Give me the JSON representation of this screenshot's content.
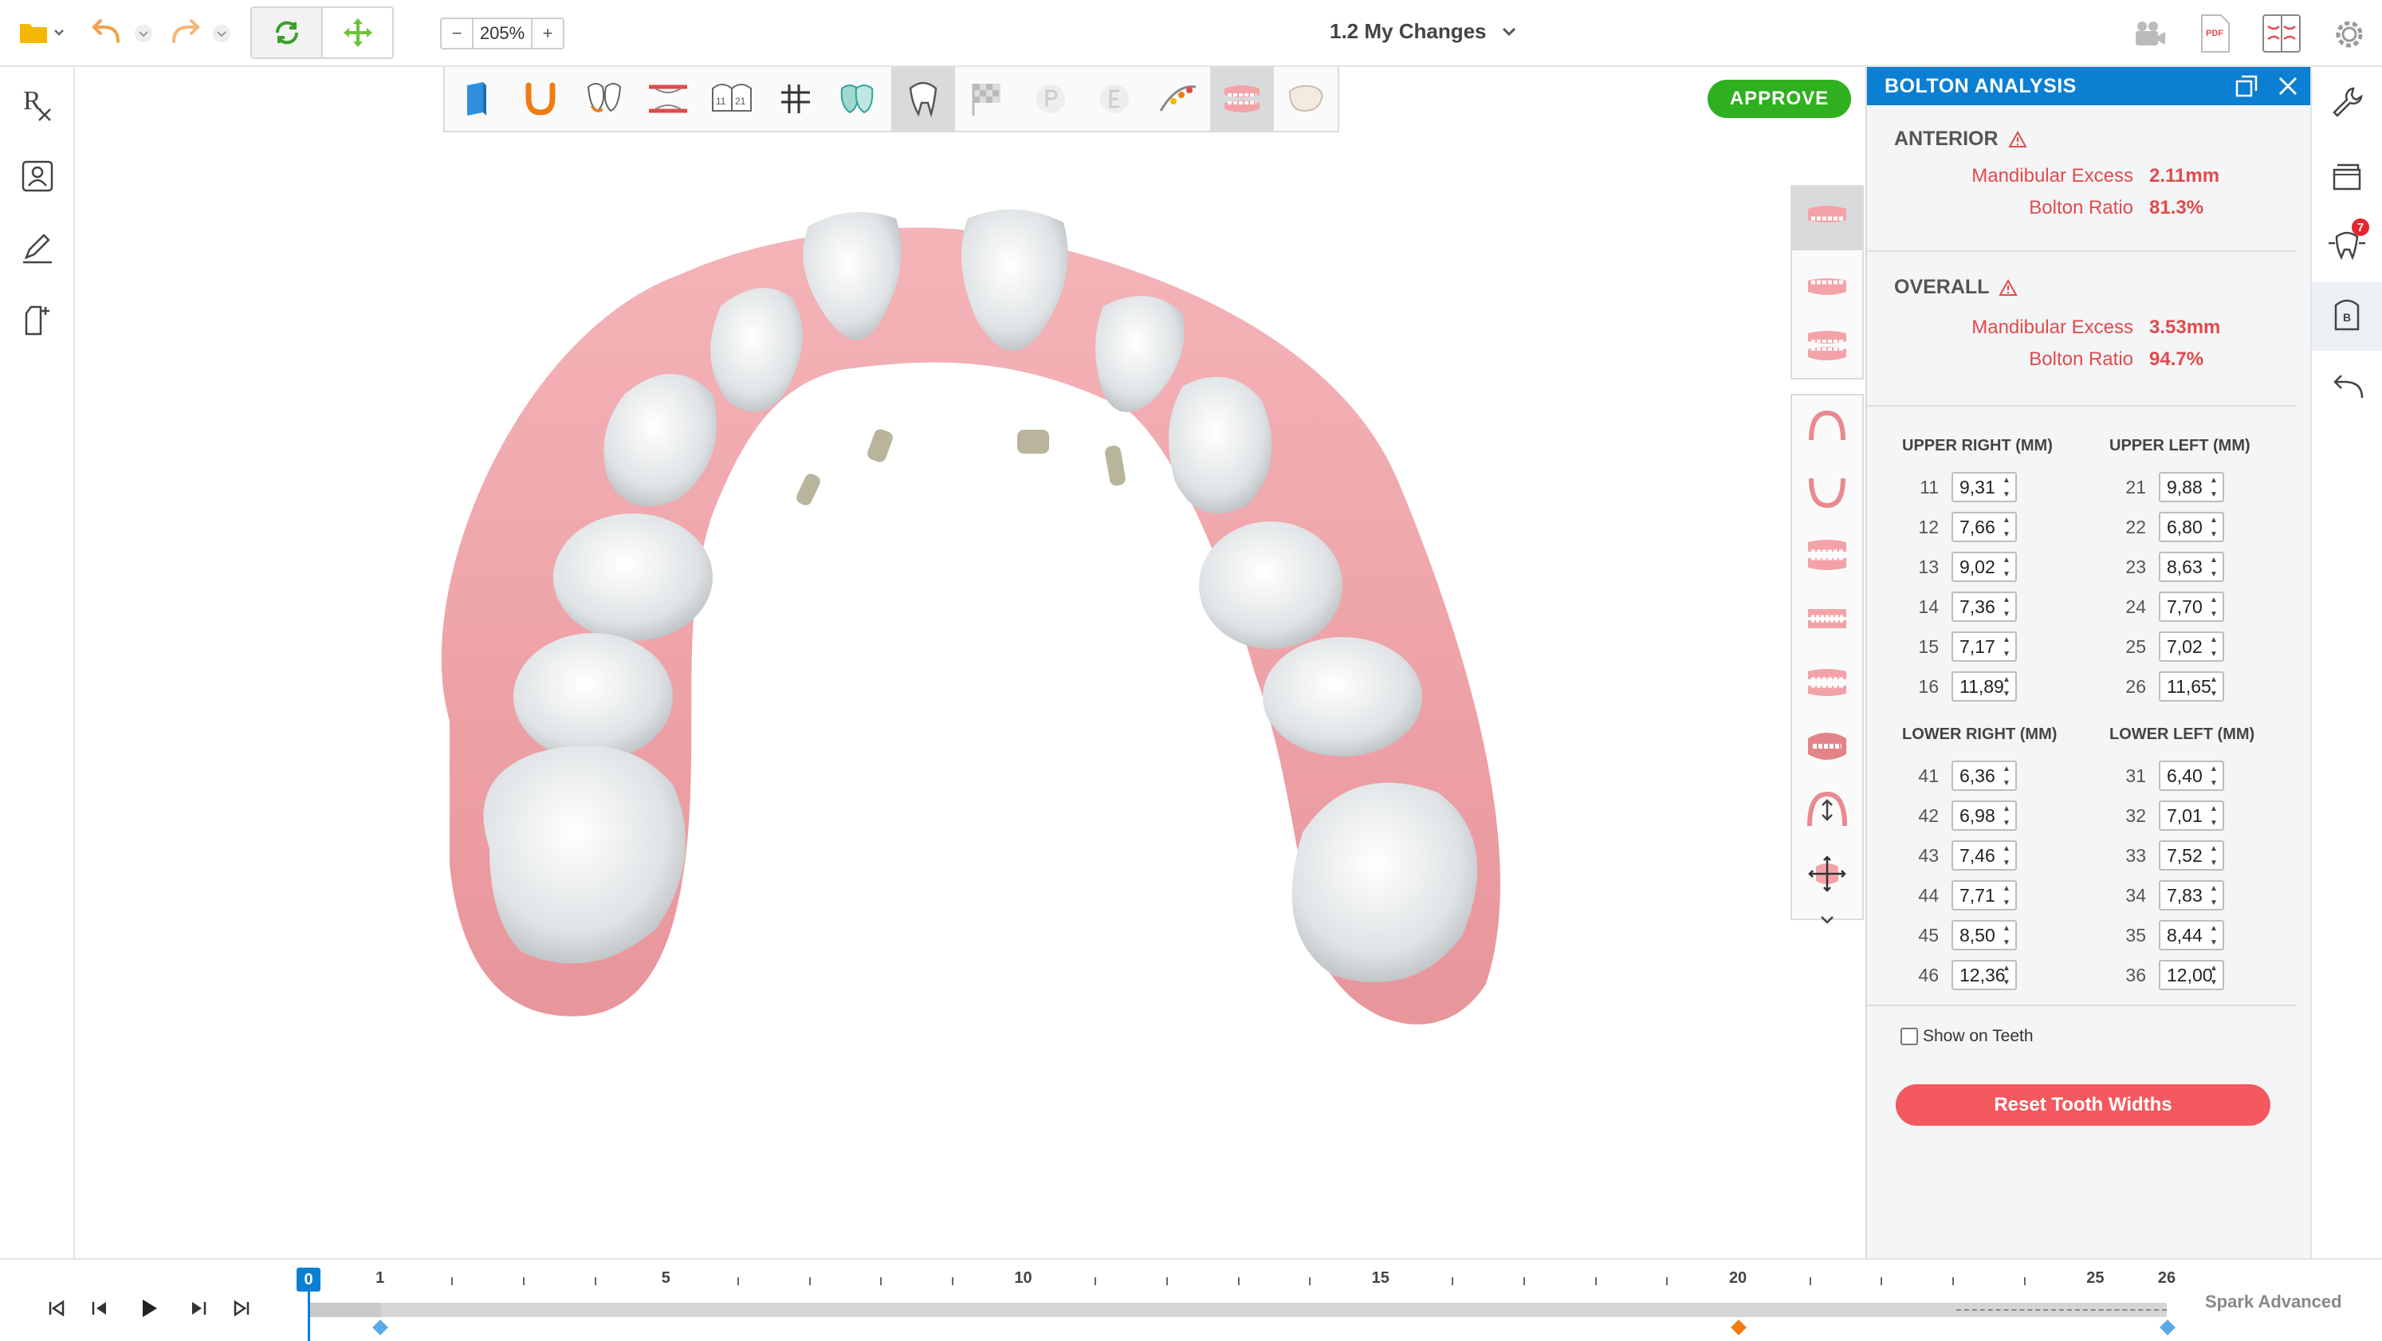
{
  "topbar": {
    "zoom_minus": "−",
    "zoom_value": "205%",
    "zoom_plus": "+",
    "doc_title": "1.2 My Changes",
    "pdf_label": "PDF"
  },
  "left_sidebar": {
    "rx_label": "R"
  },
  "approve_label": "APPROVE",
  "panel": {
    "title": "BOLTON ANALYSIS",
    "anterior": {
      "title": "ANTERIOR",
      "excess_label": "Mandibular Excess",
      "excess_value": "2.11mm",
      "ratio_label": "Bolton Ratio",
      "ratio_value": "81.3%"
    },
    "overall": {
      "title": "OVERALL",
      "excess_label": "Mandibular Excess",
      "excess_value": "3.53mm",
      "ratio_label": "Bolton Ratio",
      "ratio_value": "94.7%"
    },
    "upper_right_title": "UPPER RIGHT (MM)",
    "upper_left_title": "UPPER LEFT (MM)",
    "lower_right_title": "LOWER RIGHT (MM)",
    "lower_left_title": "LOWER LEFT (MM)",
    "upper_right": [
      {
        "tooth": "11",
        "width": "9,31"
      },
      {
        "tooth": "12",
        "width": "7,66"
      },
      {
        "tooth": "13",
        "width": "9,02"
      },
      {
        "tooth": "14",
        "width": "7,36"
      },
      {
        "tooth": "15",
        "width": "7,17"
      },
      {
        "tooth": "16",
        "width": "11,89"
      }
    ],
    "upper_left": [
      {
        "tooth": "21",
        "width": "9,88"
      },
      {
        "tooth": "22",
        "width": "6,80"
      },
      {
        "tooth": "23",
        "width": "8,63"
      },
      {
        "tooth": "24",
        "width": "7,70"
      },
      {
        "tooth": "25",
        "width": "7,02"
      },
      {
        "tooth": "26",
        "width": "11,65"
      }
    ],
    "lower_right": [
      {
        "tooth": "41",
        "width": "6,36"
      },
      {
        "tooth": "42",
        "width": "6,98"
      },
      {
        "tooth": "43",
        "width": "7,46"
      },
      {
        "tooth": "44",
        "width": "7,71"
      },
      {
        "tooth": "45",
        "width": "8,50"
      },
      {
        "tooth": "46",
        "width": "12,36"
      }
    ],
    "lower_left": [
      {
        "tooth": "31",
        "width": "6,40"
      },
      {
        "tooth": "32",
        "width": "7,01"
      },
      {
        "tooth": "33",
        "width": "7,52"
      },
      {
        "tooth": "34",
        "width": "7,83"
      },
      {
        "tooth": "35",
        "width": "8,44"
      },
      {
        "tooth": "36",
        "width": "12,00"
      }
    ],
    "show_on_teeth_label": "Show on Teeth",
    "reset_label": "Reset Tooth Widths"
  },
  "right_sidebar": {
    "notification_count": "7",
    "bolton_icon_label": "B"
  },
  "timeline": {
    "current_stage": "0",
    "stage_labels": [
      "1",
      "5",
      "10",
      "15",
      "20",
      "25",
      "26"
    ],
    "product_label": "Spark Advanced"
  },
  "colors": {
    "accent": "#0b7fd1",
    "approve": "#2fb01e",
    "alert": "#e24a4a",
    "reset": "#f3595e",
    "gum": "#f0a6ab",
    "tooth": "#f2f4f5"
  }
}
